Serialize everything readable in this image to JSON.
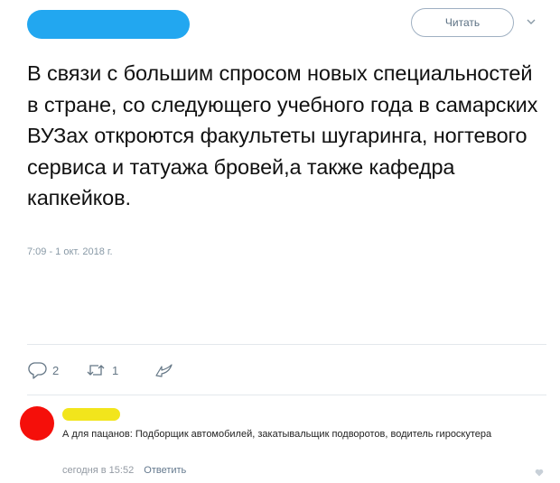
{
  "tweet": {
    "follow_label": "Читать",
    "text": "В связи с большим спросом новых специальностей в стране, со следующего учебного года в самарских ВУЗах откроются факультеты шугаринга, ногтевого сервиса и татуажа бровей,а также кафедра капкейков.",
    "timestamp": "7:09 - 1 окт. 2018 г.",
    "actions": {
      "reply_count": "2",
      "retweet_count": "1",
      "reply_icon": "speech-bubble-icon",
      "retweet_icon": "retweet-icon",
      "share_icon": "share-icon"
    },
    "colors": {
      "name_redaction": "#22a7f0",
      "follow_border": "#9fb0c2"
    }
  },
  "comment": {
    "text": "А для пацанов: Подборщик автомобилей, закатывальщик подворотов, водитель гироскутера",
    "time": "сегодня в 15:52",
    "reply_label": "Ответить",
    "like_icon": "heart-icon",
    "colors": {
      "avatar": "#f50f0a",
      "author_redaction": "#f2e51c"
    }
  }
}
